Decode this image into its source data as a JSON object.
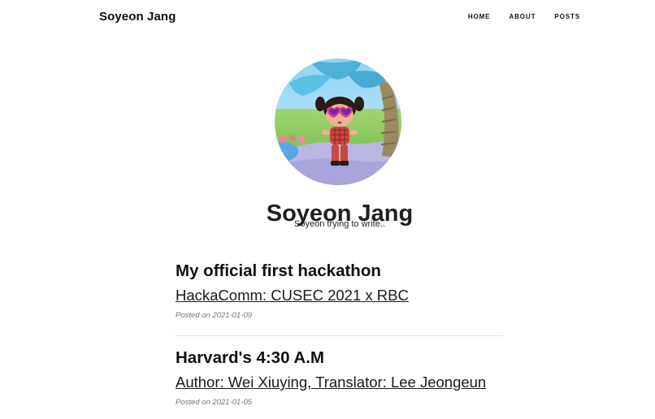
{
  "navbar": {
    "brand": "Soyeon Jang",
    "links": [
      {
        "label": "HOME"
      },
      {
        "label": "ABOUT"
      },
      {
        "label": "POSTS"
      }
    ]
  },
  "header": {
    "avatar_icon": "avatar-image",
    "title": "Soyeon Jang",
    "subtitle": "Soyeon trying to write.."
  },
  "posts": [
    {
      "title": "My official first hackathon",
      "subtitle": "HackaComm: CUSEC 2021 x RBC",
      "meta_prefix": "Posted on",
      "date": "2021-01-09"
    },
    {
      "title": "Harvard's 4:30 A.M",
      "subtitle": "Author: Wei Xiuying, Translator: Lee Jeongeun",
      "meta_prefix": "Posted on",
      "date": "2021-01-05"
    }
  ]
}
